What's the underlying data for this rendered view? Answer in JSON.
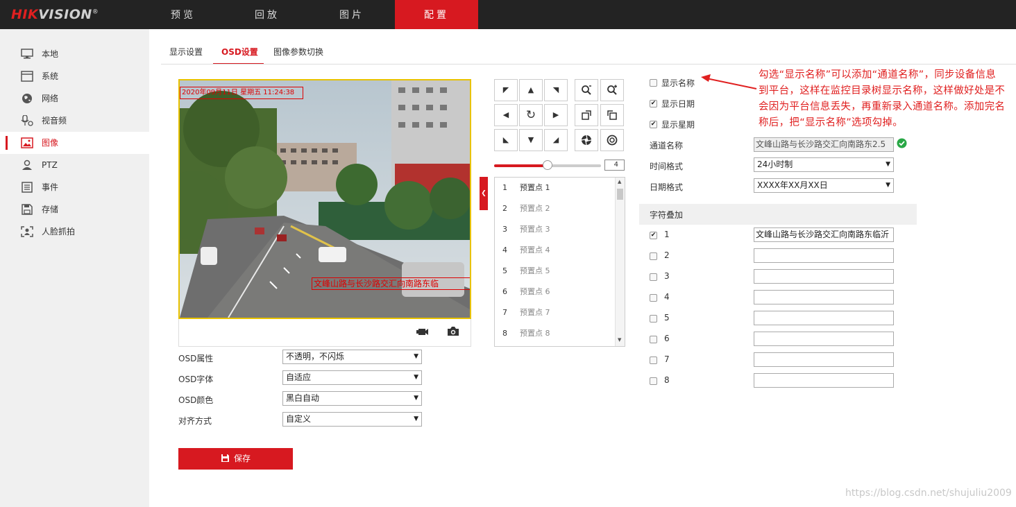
{
  "brand": {
    "logo_red": "HIK",
    "logo_rest": "VISION",
    "reg": "®"
  },
  "topnav": [
    {
      "label": "预览",
      "active": false
    },
    {
      "label": "回放",
      "active": false
    },
    {
      "label": "图片",
      "active": false
    },
    {
      "label": "配置",
      "active": true
    }
  ],
  "sidebar": [
    {
      "label": "本地",
      "icon": "monitor-icon"
    },
    {
      "label": "系统",
      "icon": "system-window-icon"
    },
    {
      "label": "网络",
      "icon": "globe-icon"
    },
    {
      "label": "视音频",
      "icon": "mic-camera-icon"
    },
    {
      "label": "图像",
      "icon": "image-icon",
      "active": true
    },
    {
      "label": "PTZ",
      "icon": "person-ptz-icon"
    },
    {
      "label": "事件",
      "icon": "event-list-icon"
    },
    {
      "label": "存储",
      "icon": "floppy-disk-icon"
    },
    {
      "label": "人脸抓拍",
      "icon": "face-capture-icon"
    }
  ],
  "tabs": [
    {
      "label": "显示设置",
      "active": false
    },
    {
      "label": "OSD设置",
      "active": true
    },
    {
      "label": "图像参数切换",
      "active": false
    }
  ],
  "video": {
    "osd_time_overlay": "2020年09月11日 星期五 11:24:38",
    "osd_text_overlay": "文峰山路与长沙路交汇向南路东临"
  },
  "osd_settings": {
    "attr_label": "OSD属性",
    "attr_value": "不透明，不闪烁",
    "font_label": "OSD字体",
    "font_value": "自适应",
    "color_label": "OSD颜色",
    "color_value": "黑白自动",
    "align_label": "对齐方式",
    "align_value": "自定义"
  },
  "save_label": "保存",
  "ptz": {
    "speed": "4",
    "speed_level": 0.5,
    "presets": [
      {
        "num": "1",
        "name": "预置点 1"
      },
      {
        "num": "2",
        "name": "预置点 2"
      },
      {
        "num": "3",
        "name": "预置点 3"
      },
      {
        "num": "4",
        "name": "预置点 4"
      },
      {
        "num": "5",
        "name": "预置点 5"
      },
      {
        "num": "6",
        "name": "预置点 6"
      },
      {
        "num": "7",
        "name": "预置点 7"
      },
      {
        "num": "8",
        "name": "预置点 8"
      }
    ]
  },
  "display": {
    "show_name_label": "显示名称",
    "show_name_checked": false,
    "show_date_label": "显示日期",
    "show_date_checked": true,
    "show_week_label": "显示星期",
    "show_week_checked": true,
    "channel_name_label": "通道名称",
    "channel_name_value": "文峰山路与长沙路交汇向南路东2.5",
    "time_format_label": "时间格式",
    "time_format_value": "24小时制",
    "date_format_label": "日期格式",
    "date_format_value": "XXXX年XX月XX日"
  },
  "overlay": {
    "section_title": "字符叠加",
    "rows": [
      {
        "num": "1",
        "checked": true,
        "value": "文峰山路与长沙路交汇向南路东临沂"
      },
      {
        "num": "2",
        "checked": false,
        "value": ""
      },
      {
        "num": "3",
        "checked": false,
        "value": ""
      },
      {
        "num": "4",
        "checked": false,
        "value": ""
      },
      {
        "num": "5",
        "checked": false,
        "value": ""
      },
      {
        "num": "6",
        "checked": false,
        "value": ""
      },
      {
        "num": "7",
        "checked": false,
        "value": ""
      },
      {
        "num": "8",
        "checked": false,
        "value": ""
      }
    ]
  },
  "annotation": "勾选“显示名称”可以添加“通道名称”，同步设备信息到平台，这样在监控目录树显示名称，这样做好处是不会因为平台信息丢失，再重新录入通道名称。添加完名称后，把“显示名称”选项勾掉。",
  "watermark": "https://blog.csdn.net/shujuliu2009",
  "colors": {
    "accent": "#d71920",
    "topbar": "#232323",
    "sidebar": "#f0f0f0"
  }
}
